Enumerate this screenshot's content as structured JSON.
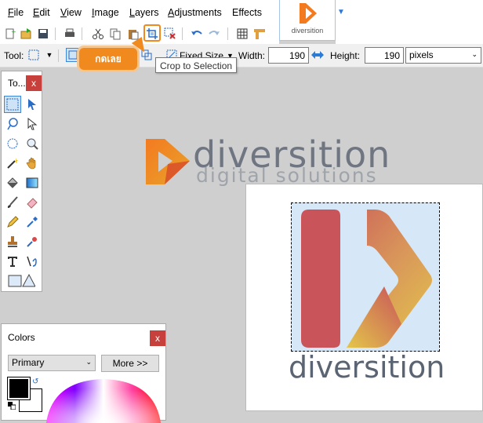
{
  "menu": [
    {
      "label": "File",
      "key": "F",
      "rest": "ile"
    },
    {
      "label": "Edit",
      "key": "E",
      "rest": "dit"
    },
    {
      "label": "View",
      "key": "V",
      "rest": "iew"
    },
    {
      "label": "Image",
      "key": "I",
      "rest": "mage"
    },
    {
      "label": "Layers",
      "key": "L",
      "rest": "ayers"
    },
    {
      "label": "Adjustments",
      "key": "A",
      "rest": "djustments"
    },
    {
      "label": "Effects",
      "key": "",
      "rest": "Effects"
    }
  ],
  "document_tab": {
    "caption": "diversition"
  },
  "tooltip": "Crop to Selection",
  "callout": "กดเลย",
  "options": {
    "tool_label": "Tool:",
    "mode_label": "Fixed Size",
    "width_label": "Width:",
    "width_value": "190",
    "height_label": "Height:",
    "height_value": "190",
    "units": "pixels"
  },
  "tools_panel": {
    "title": "To...",
    "close": "x"
  },
  "colors_panel": {
    "title": "Colors",
    "close": "x",
    "mode": "Primary",
    "more_button": "More >>"
  },
  "watermark": {
    "brand": "diversition",
    "tagline": "digital solutions"
  },
  "image_text": "diversition",
  "colors": {
    "accent": "#f08a1e",
    "logo_orange": "#f47a20",
    "logo_red": "#c9555a",
    "logo_yellow": "#e3c64a",
    "selection": "#d6e7f8",
    "close_red": "#c8403b"
  }
}
